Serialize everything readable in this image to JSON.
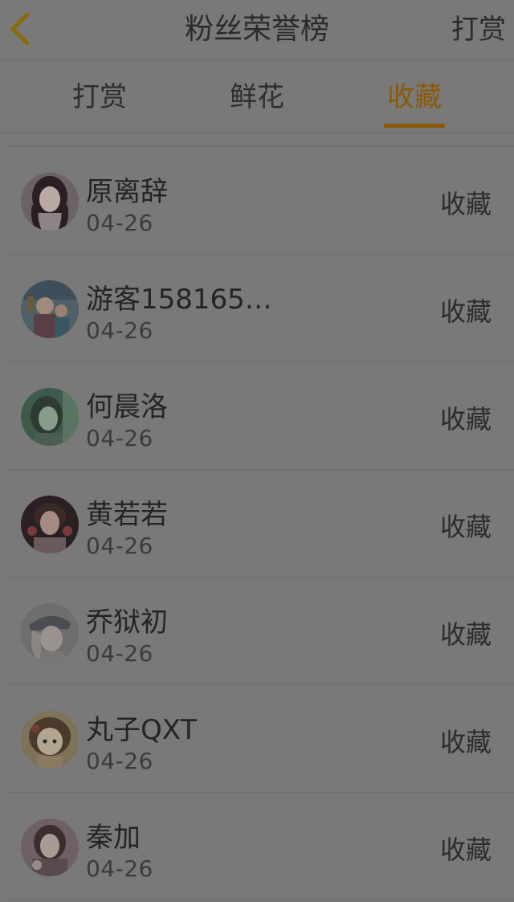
{
  "header": {
    "title": "粉丝荣誉榜",
    "right_action": "打赏",
    "back_icon": "chevron-left-icon",
    "back_icon_color": "#8c6a0a"
  },
  "tabs": [
    {
      "label": "打赏",
      "active": false
    },
    {
      "label": "鲜花",
      "active": false
    },
    {
      "label": "收藏",
      "active": true
    }
  ],
  "colors": {
    "background": "#797979",
    "accent": "#8c5a07",
    "text": "#2a2a2a"
  },
  "list": {
    "items": [
      {
        "name": "原离辞",
        "date": "04-26",
        "action": "收藏",
        "avatar": "avatar-girl-photo"
      },
      {
        "name": "游客158165…",
        "date": "04-26",
        "action": "收藏",
        "avatar": "avatar-child-photo"
      },
      {
        "name": "何晨洛",
        "date": "04-26",
        "action": "收藏",
        "avatar": "avatar-girl-green-photo"
      },
      {
        "name": "黄若若",
        "date": "04-26",
        "action": "收藏",
        "avatar": "avatar-boy-photo"
      },
      {
        "name": "乔狱初",
        "date": "04-26",
        "action": "收藏",
        "avatar": "avatar-cap-photo"
      },
      {
        "name": "丸子QXT",
        "date": "04-26",
        "action": "收藏",
        "avatar": "avatar-cartoon-girl"
      },
      {
        "name": "秦加",
        "date": "04-26",
        "action": "收藏",
        "avatar": "avatar-woman-photo"
      }
    ]
  }
}
